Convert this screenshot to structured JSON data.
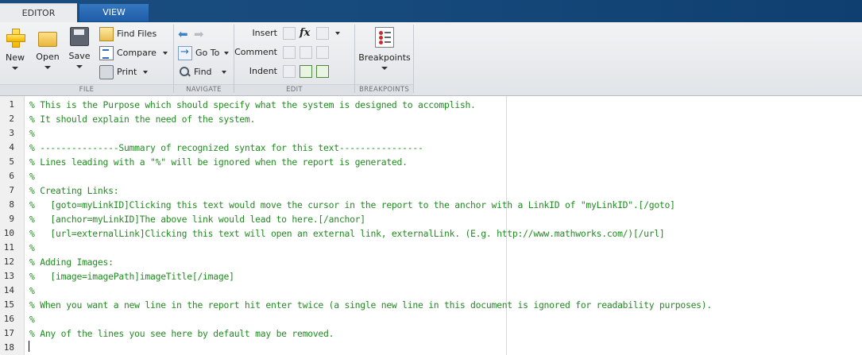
{
  "tabs": [
    {
      "label": "EDITOR",
      "active": true
    },
    {
      "label": "VIEW",
      "active": false
    }
  ],
  "ribbon": {
    "file": {
      "title": "FILE",
      "new_label": "New",
      "open_label": "Open",
      "save_label": "Save",
      "find_files_label": "Find Files",
      "compare_label": "Compare",
      "print_label": "Print"
    },
    "navigate": {
      "title": "NAVIGATE",
      "goto_label": "Go To",
      "find_label": "Find"
    },
    "edit": {
      "title": "EDIT",
      "insert_label": "Insert",
      "comment_label": "Comment",
      "indent_label": "Indent",
      "fx_label": "fx"
    },
    "breakpoints": {
      "title": "BREAKPOINTS",
      "breakpoints_label": "Breakpoints"
    }
  },
  "editor": {
    "line_numbers": [
      "1",
      "2",
      "3",
      "4",
      "5",
      "6",
      "7",
      "8",
      "9",
      "10",
      "11",
      "12",
      "13",
      "14",
      "15",
      "16",
      "17",
      "18"
    ],
    "lines": [
      "% This is the Purpose which should specify what the system is designed to accomplish.",
      "% It should explain the need of the system.",
      "%",
      "% ---------------Summary of recognized syntax for this text----------------",
      "% Lines leading with a \"%\" will be ignored when the report is generated.",
      "%",
      "% Creating Links:",
      "%   [goto=myLinkID]Clicking this text would move the cursor in the report to the anchor with a LinkID of \"myLinkID\".[/goto]",
      "%   [anchor=myLinkID]The above link would lead to here.[/anchor]",
      "%   [url=externalLink]Clicking this text will open an external link, externalLink. (E.g. http://www.mathworks.com/)[/url]",
      "%",
      "% Adding Images:",
      "%   [image=imagePath]imageTitle[/image]",
      "%",
      "% When you want a new line in the report hit enter twice (a single new line in this document is ignored for readability purposes).",
      "%",
      "% Any of the lines you see here by default may be removed.",
      ""
    ],
    "text_color": "#228b22"
  }
}
